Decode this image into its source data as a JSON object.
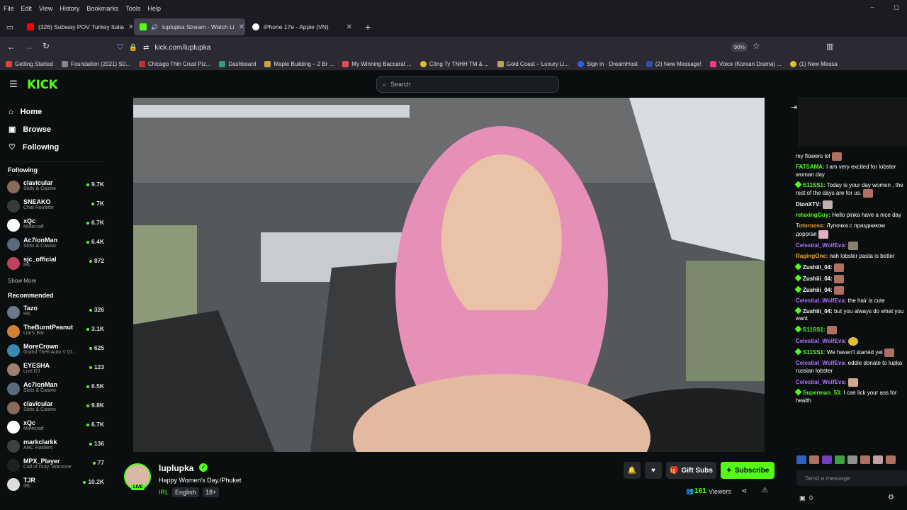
{
  "menubar": {
    "items": [
      "File",
      "Edit",
      "View",
      "History",
      "Bookmarks",
      "Tools",
      "Help"
    ]
  },
  "tabs": [
    {
      "label": "(326) Subway POV Turkey Italia",
      "color": "#ff0000"
    },
    {
      "label": "luplupka Stream - Watch Li",
      "color": "#53fc18"
    },
    {
      "label": "iPhone 17e - Apple (VN)",
      "color": "#ffffff"
    }
  ],
  "url": "kick.com/luplupka",
  "zoom": "90%",
  "bookmarks": [
    "Getting Started",
    "Foundation (2021) S0...",
    "Chicago Thin Crust Piz...",
    "Dashboard",
    "Maple Building – 2 Br ...",
    "My Winning Baccarat ...",
    "Công Ty TNHH TM & ...",
    "Gold Coast – Luxury Li...",
    "Sign in · DreamHost",
    "(2) New Message!",
    "Voice (Korean Drama) ...",
    "(1) New Messa"
  ],
  "logo": "KICK",
  "search_placeholder": "Search",
  "nav": {
    "home": "Home",
    "browse": "Browse",
    "following": "Following"
  },
  "following_title": "Following",
  "following": [
    {
      "name": "clavicular",
      "cat": "Slots & Casino",
      "viewers": "9.7K",
      "color": "#8a6a5a"
    },
    {
      "name": "SNEAKO",
      "cat": "Chat Roulette",
      "viewers": "7K",
      "color": "#3a3a3a"
    },
    {
      "name": "xQc",
      "cat": "Minecraft",
      "viewers": "6.7K",
      "color": "#ffffff"
    },
    {
      "name": "Ac7ionMan",
      "cat": "Slots & Casino",
      "viewers": "6.4K",
      "color": "#5a6a7a"
    },
    {
      "name": "sjc_official",
      "cat": "IRL",
      "viewers": "872",
      "color": "#c04060"
    }
  ],
  "show_more": "Show More",
  "recommended_title": "Recommended",
  "recommended": [
    {
      "name": "Tazo",
      "cat": "IRL",
      "viewers": "326",
      "color": "#6a7a8a"
    },
    {
      "name": "TheBurntPeanut",
      "cat": "Liar's Bar",
      "viewers": "3.1K",
      "color": "#d08030"
    },
    {
      "name": "MoreCrown",
      "cat": "Grand Theft Auto V (G...",
      "viewers": "625",
      "color": "#3a8ab0"
    },
    {
      "name": "EYESHA",
      "cat": "Live DJ",
      "viewers": "123",
      "color": "#a08070"
    },
    {
      "name": "Ac7ionMan",
      "cat": "Slots & Casino",
      "viewers": "6.5K",
      "color": "#5a6a7a"
    },
    {
      "name": "clavicular",
      "cat": "Slots & Casino",
      "viewers": "9.8K",
      "color": "#8a6a5a"
    },
    {
      "name": "xQc",
      "cat": "Minecraft",
      "viewers": "6.7K",
      "color": "#ffffff"
    },
    {
      "name": "markclarkk",
      "cat": "ARC Raiders",
      "viewers": "136",
      "color": "#404040"
    },
    {
      "name": "MPX_Player",
      "cat": "Call of Duty: Warzone",
      "viewers": "77",
      "color": "#202020"
    },
    {
      "name": "TJR",
      "cat": "IRL",
      "viewers": "10.2K",
      "color": "#dddddd"
    }
  ],
  "streamer": {
    "name": "luplupka",
    "title": "Happy Women's Day./Phuket",
    "category": "IRL",
    "tags": [
      "English",
      "18+"
    ],
    "live": "LIVE",
    "viewers": "161",
    "viewers_label": "Viewers"
  },
  "buttons": {
    "gift": "Gift Subs",
    "subscribe": "Subscribe"
  },
  "chat": [
    {
      "user": "",
      "text": "my flowers lol",
      "ucolor": "#fff",
      "badge": false,
      "emote": true
    },
    {
      "user": "FATSAMA:",
      "text": "I am very excited for lobster woman day",
      "ucolor": "#53fc18",
      "badge": false,
      "emote": false
    },
    {
      "user": "S11SS1:",
      "text": "Today is your day women , the rest of the days are for us.",
      "ucolor": "#53fc18",
      "badge": true,
      "emote": true
    },
    {
      "user": "DionXTV:",
      "text": "",
      "ucolor": "#fff",
      "badge": false,
      "emote": true
    },
    {
      "user": "relaxingGuy:",
      "text": "Hello pinka have a nice day",
      "ucolor": "#53fc18",
      "badge": false,
      "emote": false
    },
    {
      "user": "Totorooss:",
      "text": "Лупочка с праздником дорогая",
      "ucolor": "#f0a030",
      "badge": false,
      "emote": true
    },
    {
      "user": "Celestial_WolfEva:",
      "text": "",
      "ucolor": "#b070ff",
      "badge": false,
      "emote": true
    },
    {
      "user": "RagingOne:",
      "text": "nah lobster pasta is better",
      "ucolor": "#f0a030",
      "badge": false,
      "emote": false
    },
    {
      "user": "Zushiii_04:",
      "text": "",
      "ucolor": "#fff",
      "badge": true,
      "emote": true
    },
    {
      "user": "Zushiii_04:",
      "text": "",
      "ucolor": "#fff",
      "badge": true,
      "emote": true
    },
    {
      "user": "Zushiii_04:",
      "text": "",
      "ucolor": "#fff",
      "badge": true,
      "emote": true
    },
    {
      "user": "Celestial_WolfEva:",
      "text": "the hair is cute",
      "ucolor": "#b070ff",
      "badge": false,
      "emote": false
    },
    {
      "user": "Zushiii_04:",
      "text": "but you always do what you want",
      "ucolor": "#fff",
      "badge": true,
      "emote": false
    },
    {
      "user": "S11SS1:",
      "text": "",
      "ucolor": "#53fc18",
      "badge": true,
      "emote": true
    },
    {
      "user": "Celestial_WolfEva:",
      "text": "",
      "ucolor": "#b070ff",
      "badge": false,
      "emote": true
    },
    {
      "user": "S11SS1:",
      "text": "We haven't started yet",
      "ucolor": "#53fc18",
      "badge": true,
      "emote": true
    },
    {
      "user": "Celestial_WolfEva:",
      "text": "eddie donate to lupka russian lobster",
      "ucolor": "#b070ff",
      "badge": false,
      "emote": false
    },
    {
      "user": "Celestial_WolfEva:",
      "text": "",
      "ucolor": "#b070ff",
      "badge": false,
      "emote": true
    },
    {
      "user": "Superman_53:",
      "text": "I can lick your ass for health",
      "ucolor": "#53fc18",
      "badge": true,
      "emote": false
    }
  ],
  "chat_placeholder": "Send a message",
  "chat_count": "0"
}
